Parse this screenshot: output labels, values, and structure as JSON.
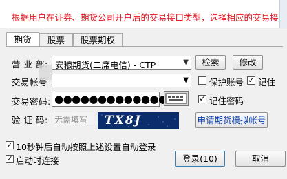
{
  "banner": {
    "text": "根据用户在证券、期货公司开户后的交易接口类型，选择相应的交易接口。"
  },
  "tabs": [
    {
      "label": "期货",
      "active": true
    },
    {
      "label": "股票",
      "active": false
    },
    {
      "label": "股票期权",
      "active": false
    }
  ],
  "form": {
    "broker_label": "营 业 部:",
    "broker_value": "安粮期货(二席电信) - CTP",
    "search_label": "检索",
    "modify_label": "修改",
    "account_label": "交易帐号",
    "account_value": "",
    "protect_account_label": "保护账号",
    "protect_account_checked": false,
    "remember_label": "记住",
    "remember_checked": true,
    "password_label": "交易密码:",
    "password_value": "●●●●●●●●●●●●●",
    "remember_password_label": "记住密码",
    "remember_password_checked": true,
    "captcha_label": "验 证 码:",
    "captcha_placeholder": "无需填写",
    "captcha_image_text": "TX8J",
    "apply_sim_label": "申请期货模拟帐号"
  },
  "options": {
    "auto_login_label": "10秒钟后自动按照上述设置自动登录",
    "auto_login_checked": true,
    "auto_connect_label": "启动时连接",
    "auto_connect_checked": true
  },
  "actions": {
    "login_label": "登录(10)",
    "cancel_label": "取消"
  },
  "colors": {
    "banner_text": "#e0161f",
    "link_blue": "#0b3ea8",
    "captcha_bg": "#0c2d6b"
  }
}
